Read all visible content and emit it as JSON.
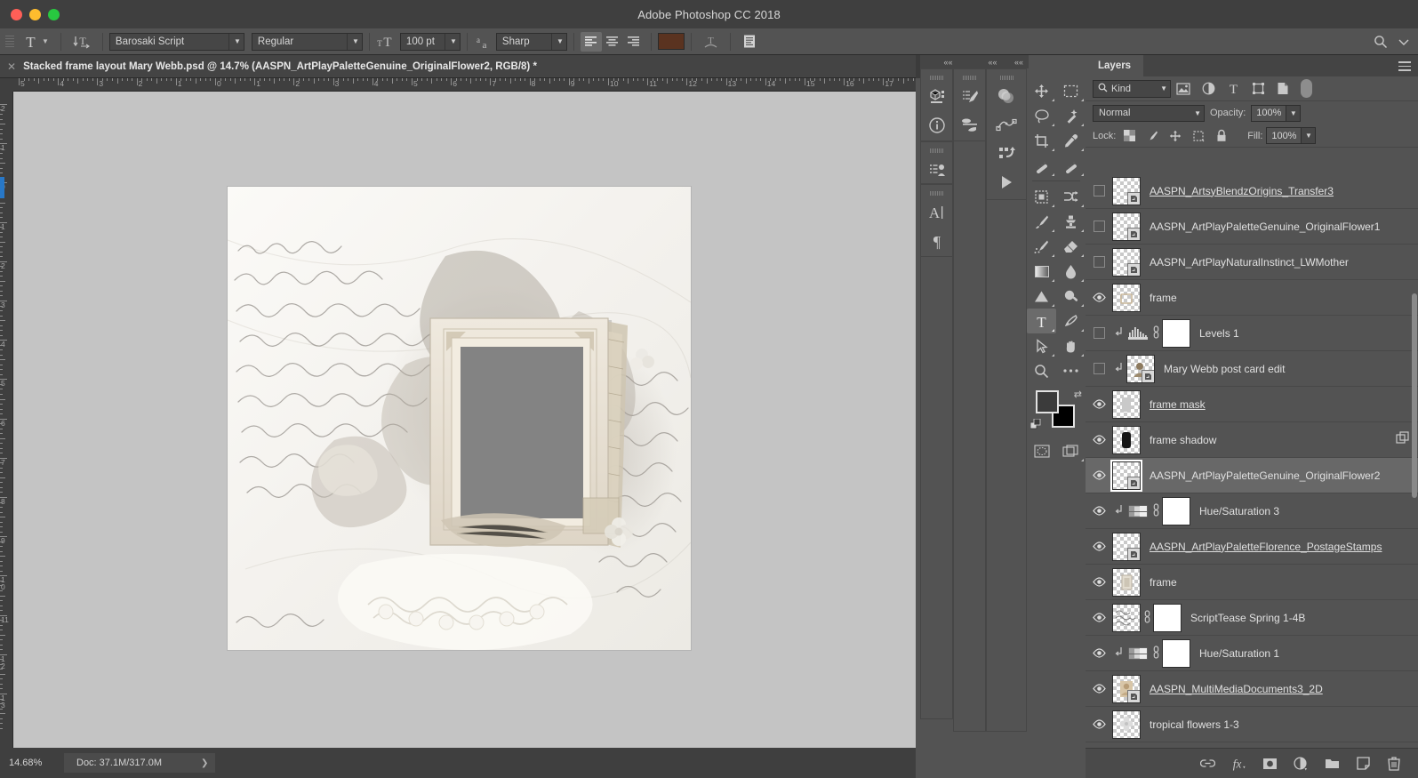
{
  "window": {
    "app_title": "Adobe Photoshop CC 2018"
  },
  "options_bar": {
    "tool_icon": "type-tool-icon",
    "orientation_icon": "text-orientation-icon",
    "font_family": "Barosaki Script",
    "font_style": "Regular",
    "font_size": "100 pt",
    "anti_alias_icon": "anti-alias-icon",
    "anti_alias": "Sharp",
    "align_left": "align-left-icon",
    "align_center": "align-center-icon",
    "align_right": "align-right-icon",
    "color_label": "text-color",
    "text_color": "#5a3320",
    "warp_icon": "warp-text-icon",
    "panels_icon": "character-panel-icon",
    "search_icon": "search-icon",
    "workspace_icon": "workspace-chevron-icon"
  },
  "document_tab": {
    "close_icon": "close-icon",
    "title": "Stacked frame layout Mary Webb.psd @ 14.7% (AASPN_ArtPlayPaletteGenuine_OriginalFlower2, RGB/8) *"
  },
  "rulers": {
    "horizontal": [
      "5",
      "4",
      "3",
      "2",
      "1",
      "0",
      "1",
      "2",
      "3",
      "4",
      "5",
      "6",
      "7",
      "8",
      "9",
      "10",
      "11",
      "12",
      "13",
      "14",
      "15",
      "16",
      "17"
    ],
    "vertical": [
      "2",
      "1",
      "0",
      "1",
      "2",
      "3",
      "4",
      "5",
      "6",
      "7",
      "8",
      "9",
      "10",
      "11",
      "12",
      "13"
    ],
    "units": "inches"
  },
  "status_bar": {
    "zoom": "14.68%",
    "doc_info": "Doc: 37.1M/317.0M",
    "expand_icon": "chevron-right-icon"
  },
  "icon_docks": {
    "collapse_labels": [
      "«",
      "«",
      "«"
    ],
    "column1": [
      "3d-panel-icon",
      "info-panel-icon",
      "clone-source-icon",
      "character-icon",
      "paragraph-icon"
    ],
    "column2": [
      "brush-settings-icon",
      "brush-presets-icon"
    ],
    "column3": [
      "adjustments-icon",
      "paths-icon",
      "actions-icon",
      "play-icon"
    ]
  },
  "toolbox": {
    "tools": [
      "move-tool-icon",
      "rectangular-marquee-tool-icon",
      "lasso-tool-icon",
      "magic-wand-tool-icon",
      "crop-tool-icon",
      "eyedropper-tool-icon",
      "healing-brush-tool-icon",
      "spot-healing-tool-icon",
      "frame-tool-icon",
      "shuffle-tool-icon",
      "brush-tool-icon",
      "clone-stamp-tool-icon",
      "history-brush-tool-icon",
      "eraser-tool-icon",
      "gradient-tool-icon",
      "blur-tool-icon",
      "dodge-tool-icon",
      "burn-tool-icon",
      "type-tool-icon",
      "pen-tool-icon",
      "path-selection-tool-icon",
      "hand-tool-icon",
      "zoom-tool-icon",
      "more-tools-icon"
    ],
    "active_tool": "type-tool-icon",
    "foreground_color": "#3b3b3b",
    "background_color": "#000000",
    "swap_icon": "swap-colors-icon",
    "default_icon": "default-colors-icon",
    "quick_mask_icon": "quick-mask-icon",
    "screen_mode_icon": "screen-mode-icon"
  },
  "layers_panel": {
    "tab_label": "Layers",
    "menu_icon": "panel-menu-icon",
    "filter": {
      "kind_icon": "search-icon",
      "kind_label": "Kind",
      "chevron": "chevron-down-icon",
      "filters": [
        "pixel-filter-icon",
        "adjustment-filter-icon",
        "type-filter-icon",
        "shape-filter-icon",
        "smart-object-filter-icon"
      ],
      "toggle": "filter-toggle-switch"
    },
    "blend_mode": "Normal",
    "opacity_label": "Opacity:",
    "opacity_value": "100%",
    "lock_label": "Lock:",
    "lock_icons": [
      "lock-transparency-icon",
      "lock-image-icon",
      "lock-position-icon",
      "lock-artboard-icon",
      "lock-all-icon"
    ],
    "fill_label": "Fill:",
    "fill_value": "100%",
    "layers": [
      {
        "name": "AASPN_ArtsyBlendzOrigins_Transfer3",
        "visible": false,
        "underline": true,
        "thumb": "checker",
        "smart": true,
        "clipped": false,
        "selected": false
      },
      {
        "name": "AASPN_ArtPlayPaletteGenuine_OriginalFlower1",
        "visible": false,
        "underline": false,
        "thumb": "checker",
        "smart": true,
        "clipped": false,
        "selected": false
      },
      {
        "name": "AASPN_ArtPlayNaturalInstinct_LWMother",
        "visible": false,
        "underline": false,
        "thumb": "checker",
        "smart": true,
        "clipped": false,
        "selected": false
      },
      {
        "name": "frame",
        "visible": true,
        "underline": false,
        "thumb": "checker-art",
        "smart": false,
        "clipped": false,
        "selected": false
      },
      {
        "name": "Levels 1",
        "visible": false,
        "underline": false,
        "thumb": "adjustment-levels",
        "adj_icon": "levels-icon",
        "mask": true,
        "link": true,
        "clipped": true,
        "selected": false
      },
      {
        "name": "Mary Webb post card edit",
        "visible": false,
        "underline": false,
        "thumb": "checker-photo",
        "smart": true,
        "clipped": true,
        "selected": false
      },
      {
        "name": "frame mask",
        "visible": true,
        "underline": true,
        "thumb": "checker-shape",
        "smart": false,
        "clipped": false,
        "selected": false
      },
      {
        "name": "frame shadow",
        "visible": true,
        "underline": false,
        "thumb": "checker-dark",
        "smart": false,
        "clipped": false,
        "selected": false,
        "row_icon": "layer-effects-icon"
      },
      {
        "name": "AASPN_ArtPlayPaletteGenuine_OriginalFlower2",
        "visible": true,
        "underline": false,
        "thumb": "checker",
        "smart": true,
        "clipped": false,
        "selected": true
      },
      {
        "name": "Hue/Saturation 3",
        "visible": true,
        "underline": false,
        "thumb": "adjustment-huesat",
        "adj_icon": "hue-saturation-icon",
        "mask": true,
        "link": true,
        "clipped": true,
        "selected": false
      },
      {
        "name": "AASPN_ArtPlayPaletteFlorence_PostageStamps",
        "visible": true,
        "underline": true,
        "thumb": "checker",
        "smart": true,
        "clipped": false,
        "selected": false
      },
      {
        "name": "frame",
        "visible": true,
        "underline": false,
        "thumb": "checker-frame",
        "smart": false,
        "clipped": false,
        "selected": false
      },
      {
        "name": "ScriptTease Spring 1-4B",
        "visible": true,
        "underline": false,
        "thumb": "checker-script",
        "mask": true,
        "link": true,
        "clipped": false,
        "selected": false
      },
      {
        "name": "Hue/Saturation 1",
        "visible": true,
        "underline": false,
        "thumb": "adjustment-huesat",
        "adj_icon": "hue-saturation-icon",
        "mask": true,
        "link": true,
        "clipped": true,
        "selected": false
      },
      {
        "name": "AASPN_MultiMediaDocuments3_2D",
        "visible": true,
        "underline": true,
        "thumb": "checker-doc",
        "smart": true,
        "clipped": false,
        "selected": false
      },
      {
        "name": "tropical flowers 1-3",
        "visible": true,
        "underline": false,
        "thumb": "checker-flower",
        "smart": false,
        "clipped": false,
        "selected": false
      }
    ],
    "footer_icons": [
      "link-layers-icon",
      "add-layer-style-icon",
      "add-layer-mask-icon",
      "new-adjustment-layer-icon",
      "new-group-icon",
      "new-layer-icon",
      "delete-layer-icon"
    ]
  },
  "canvas": {
    "background": "#c4c4c4",
    "artwork_description": "vintage scrapbook layout",
    "photo_placeholder_color": "#838383"
  }
}
